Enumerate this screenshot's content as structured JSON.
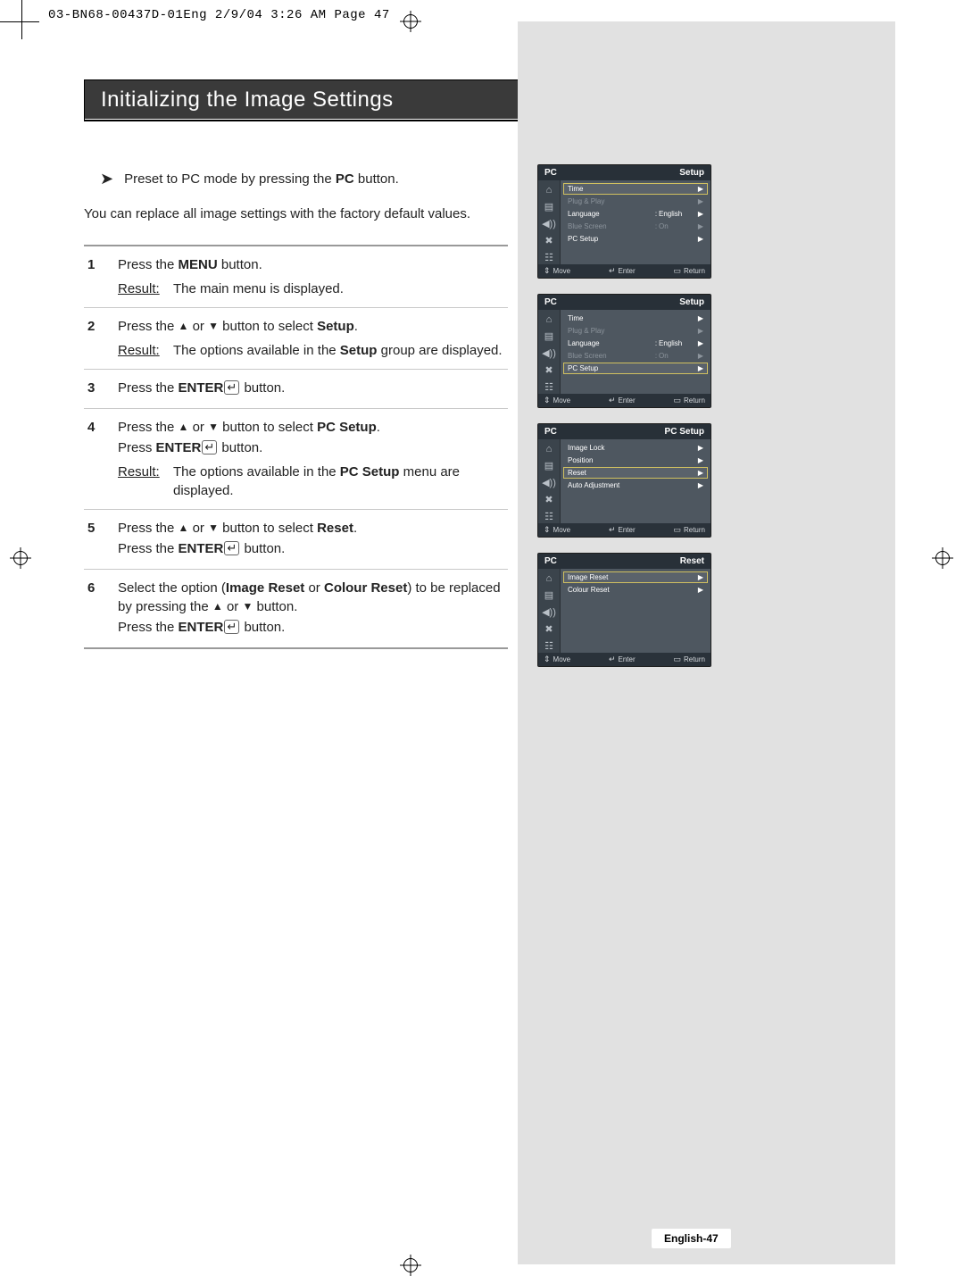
{
  "print_header": "03-BN68-00437D-01Eng  2/9/04 3:26 AM  Page 47",
  "title": "Initializing the Image Settings",
  "preset_prefix": "Preset to PC mode by pressing the ",
  "preset_bold": "PC",
  "preset_suffix": " button.",
  "intro": "You can replace all image settings with the factory default values.",
  "result_label": "Result",
  "steps": [
    {
      "num": "1",
      "lines": [
        "Press the <b>MENU</b> button."
      ],
      "result": "The main menu is displayed."
    },
    {
      "num": "2",
      "lines": [
        "Press the ▲ or ▼ button to select <b>Setup</b>."
      ],
      "result": "The options available in the <b>Setup</b> group are displayed."
    },
    {
      "num": "3",
      "lines": [
        "Press the <b>ENTER</b><e> button."
      ]
    },
    {
      "num": "4",
      "lines": [
        "Press the ▲ or ▼ button to select <b>PC Setup</b>.",
        "Press <b>ENTER</b><e> button."
      ],
      "result": "The options available in the <b>PC Setup</b> menu are displayed."
    },
    {
      "num": "5",
      "lines": [
        "Press the ▲ or ▼ button to select <b>Reset</b>.",
        "Press the <b>ENTER</b><e> button."
      ]
    },
    {
      "num": "6",
      "lines": [
        "Select the option (<b>Image Reset</b> or <b>Colour Reset</b>) to be replaced by pressing the ▲ or ▼ button.",
        "Press the <b>ENTER</b><e> button."
      ]
    }
  ],
  "osd_footer": {
    "move": "Move",
    "enter": "Enter",
    "return": "Return"
  },
  "osd_sidebar_icons": [
    "⌂",
    "▤",
    "◀))",
    "✖",
    "☷"
  ],
  "osd1": {
    "left": "PC",
    "right": "Setup",
    "items": [
      {
        "lab": "Time",
        "hl": true,
        "arr": "▶"
      },
      {
        "lab": "Plug & Play",
        "dim": true,
        "arr": "▶"
      },
      {
        "lab": "Language",
        "col": ":",
        "val": "English",
        "arr": "▶"
      },
      {
        "lab": "Blue Screen",
        "dim": true,
        "col": ":",
        "val": "On",
        "arr": "▶"
      },
      {
        "lab": "PC Setup",
        "arr": "▶"
      }
    ]
  },
  "osd2": {
    "left": "PC",
    "right": "Setup",
    "items": [
      {
        "lab": "Time",
        "arr": "▶"
      },
      {
        "lab": "Plug & Play",
        "dim": true,
        "arr": "▶"
      },
      {
        "lab": "Language",
        "col": ":",
        "val": "English",
        "arr": "▶"
      },
      {
        "lab": "Blue Screen",
        "dim": true,
        "col": ":",
        "val": "On",
        "arr": "▶"
      },
      {
        "lab": "PC Setup",
        "hl": true,
        "arr": "▶"
      }
    ]
  },
  "osd3": {
    "left": "PC",
    "right": "PC Setup",
    "items": [
      {
        "lab": "Image Lock",
        "arr": "▶"
      },
      {
        "lab": "Position",
        "arr": "▶"
      },
      {
        "lab": "Reset",
        "hl": true,
        "arr": "▶"
      },
      {
        "lab": "Auto Adjustment",
        "arr": "▶"
      }
    ]
  },
  "osd4": {
    "left": "PC",
    "right": "Reset",
    "items": [
      {
        "lab": "Image Reset",
        "hl": true,
        "arr": "▶"
      },
      {
        "lab": "Colour Reset",
        "arr": "▶"
      }
    ]
  },
  "page_label": "English-47"
}
